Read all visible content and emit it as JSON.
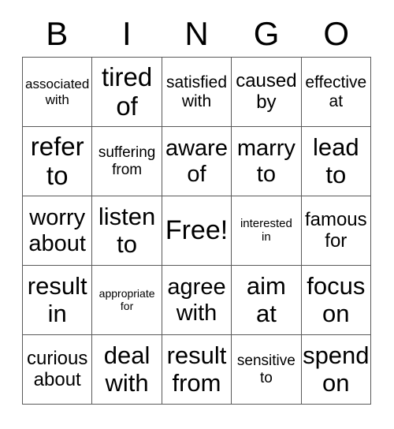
{
  "card": {
    "title": "BINGO",
    "header_letters": [
      "B",
      "I",
      "N",
      "G",
      "O"
    ],
    "grid_size": "5x5",
    "free_space": "Free!",
    "colors": {
      "background": "#ffffff",
      "text": "#000000",
      "grid_line": "#595959"
    },
    "rows": [
      [
        {
          "text": "associated\nwith",
          "size": "fs-sm"
        },
        {
          "text": "tired\nof",
          "size": "fs-xxxl"
        },
        {
          "text": "satisfied\nwith",
          "size": "fs-ml"
        },
        {
          "text": "caused\nby",
          "size": "fs-l"
        },
        {
          "text": "effective\nat",
          "size": "fs-ml"
        }
      ],
      [
        {
          "text": "refer\nto",
          "size": "fs-xxxl"
        },
        {
          "text": "suffering\nfrom",
          "size": "fs-m"
        },
        {
          "text": "aware\nof",
          "size": "fs-xl"
        },
        {
          "text": "marry\nto",
          "size": "fs-xl"
        },
        {
          "text": "lead\nto",
          "size": "fs-xxl"
        }
      ],
      [
        {
          "text": "worry\nabout",
          "size": "fs-xl"
        },
        {
          "text": "listen\nto",
          "size": "fs-xxl"
        },
        {
          "text": "Free!",
          "size": "fs-free"
        },
        {
          "text": "interested\nin",
          "size": "fs-s"
        },
        {
          "text": "famous\nfor",
          "size": "fs-l"
        }
      ],
      [
        {
          "text": "result\nin",
          "size": "fs-xxl"
        },
        {
          "text": "appropriate\nfor",
          "size": "fs-xs"
        },
        {
          "text": "agree\nwith",
          "size": "fs-xl"
        },
        {
          "text": "aim\nat",
          "size": "fs-xxl"
        },
        {
          "text": "focus\non",
          "size": "fs-xxl"
        }
      ],
      [
        {
          "text": "curious\nabout",
          "size": "fs-l"
        },
        {
          "text": "deal\nwith",
          "size": "fs-xxl"
        },
        {
          "text": "result\nfrom",
          "size": "fs-xxl"
        },
        {
          "text": "sensitive\nto",
          "size": "fs-m"
        },
        {
          "text": "spend\non",
          "size": "fs-xxl"
        }
      ]
    ]
  }
}
